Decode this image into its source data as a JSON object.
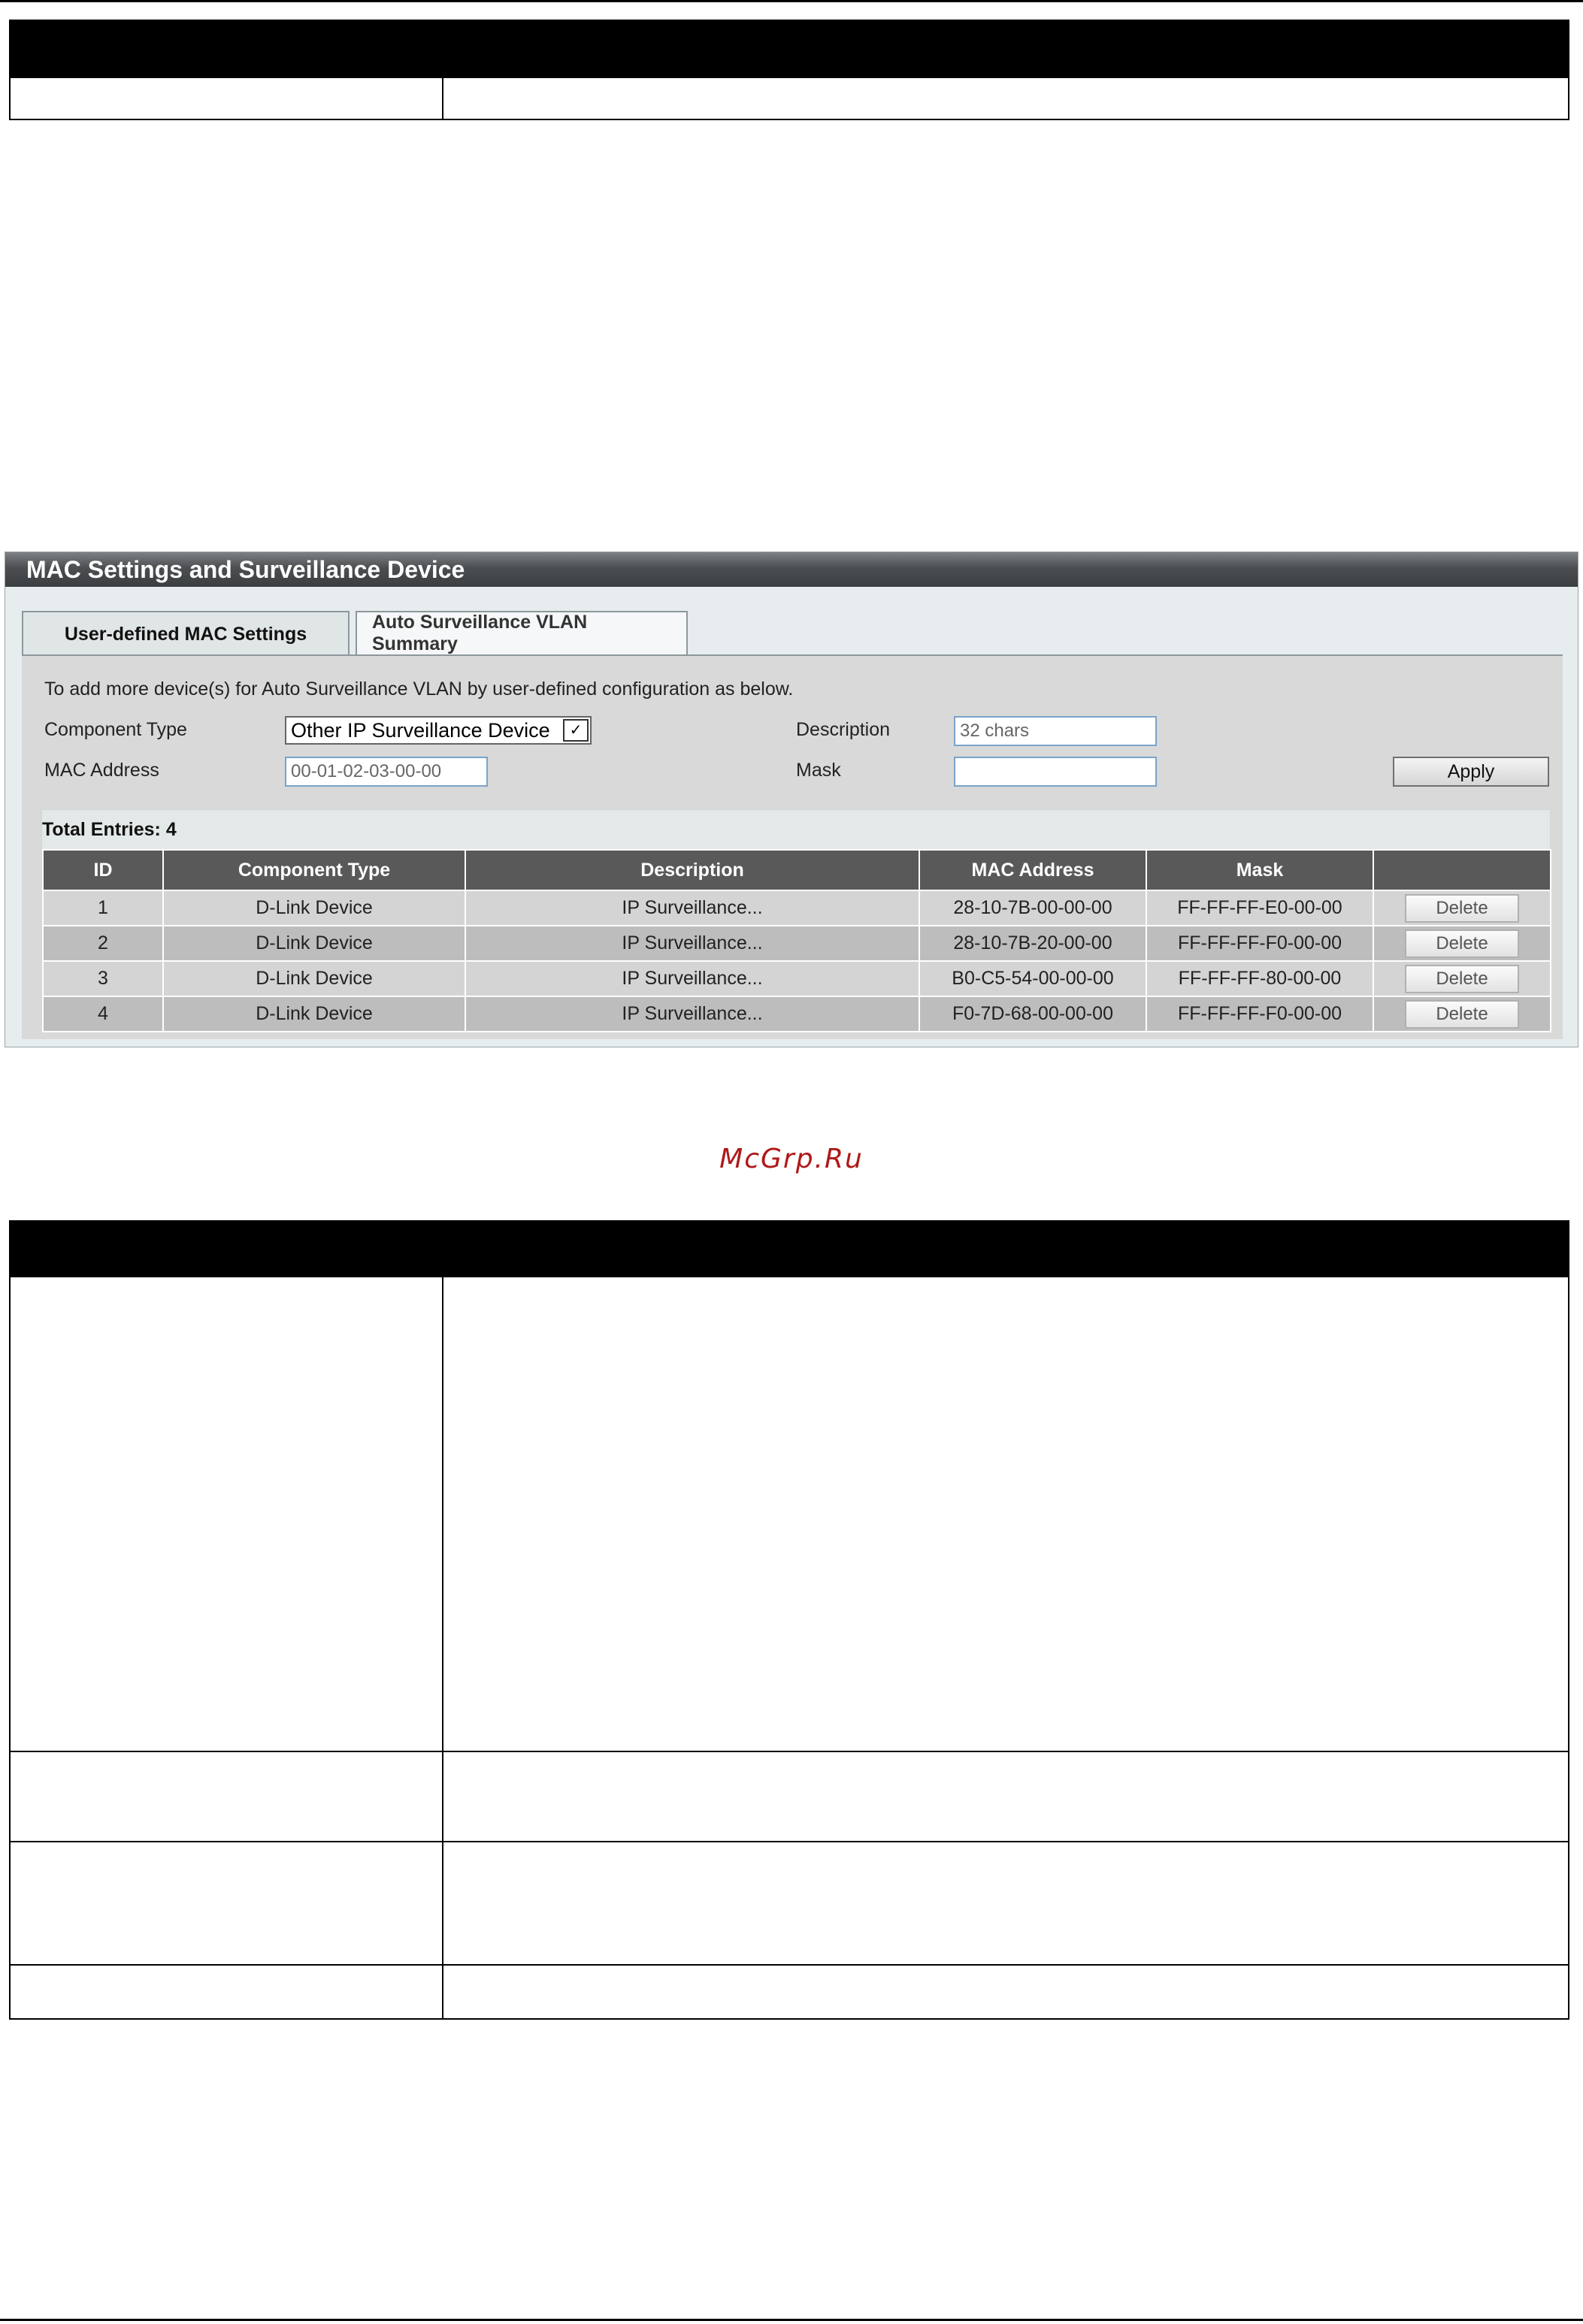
{
  "panel": {
    "title": "MAC Settings and Surveillance Device",
    "tabs": [
      {
        "label": "User-defined MAC Settings",
        "active": true
      },
      {
        "label": "Auto Surveillance VLAN Summary",
        "active": false
      }
    ],
    "intro": "To add more device(s) for Auto Surveillance VLAN by user-defined configuration as below.",
    "form": {
      "component_type_label": "Component Type",
      "component_type_value": "Other IP Surveillance Device",
      "description_label": "Description",
      "description_placeholder": "32 chars",
      "mac_label": "MAC Address",
      "mac_placeholder": "00-01-02-03-00-00",
      "mask_label": "Mask",
      "mask_value": "",
      "apply_label": "Apply"
    },
    "total_entries": "Total Entries: 4",
    "table": {
      "headers": [
        "ID",
        "Component Type",
        "Description",
        "MAC Address",
        "Mask",
        ""
      ],
      "rows": [
        {
          "id": "1",
          "component": "D-Link Device",
          "description": "IP Surveillance...",
          "mac": "28-10-7B-00-00-00",
          "mask": "FF-FF-FF-E0-00-00",
          "action": "Delete"
        },
        {
          "id": "2",
          "component": "D-Link Device",
          "description": "IP Surveillance...",
          "mac": "28-10-7B-20-00-00",
          "mask": "FF-FF-FF-F0-00-00",
          "action": "Delete"
        },
        {
          "id": "3",
          "component": "D-Link Device",
          "description": "IP Surveillance...",
          "mac": "B0-C5-54-00-00-00",
          "mask": "FF-FF-FF-80-00-00",
          "action": "Delete"
        },
        {
          "id": "4",
          "component": "D-Link Device",
          "description": "IP Surveillance...",
          "mac": "F0-7D-68-00-00-00",
          "mask": "FF-FF-FF-F0-00-00",
          "action": "Delete"
        }
      ]
    }
  },
  "watermark": "McGrp.Ru"
}
